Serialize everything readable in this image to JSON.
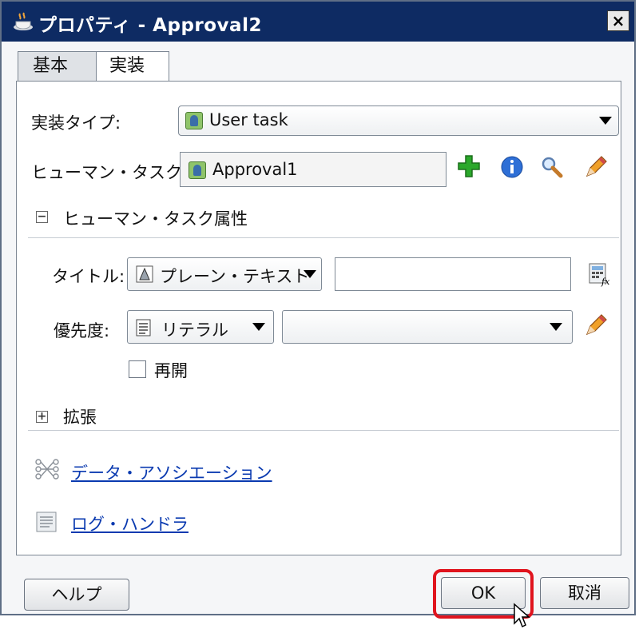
{
  "window": {
    "title": "プロパティ - Approval2",
    "close_label": "×"
  },
  "tabs": [
    {
      "label": "基本"
    },
    {
      "label": "実装"
    }
  ],
  "impl_type": {
    "label": "実装タイプ:",
    "value": "User task"
  },
  "human_task": {
    "label": "ヒューマン・タスク:",
    "value": "Approval1"
  },
  "attributes_section": {
    "label": "ヒューマン・タスク属性",
    "toggle": "−"
  },
  "title_field": {
    "label": "タイトル:",
    "mode": "プレーン・テキスト",
    "value": ""
  },
  "priority_field": {
    "label": "優先度:",
    "mode": "リテラル",
    "value": ""
  },
  "reopen": {
    "label": "再開",
    "checked": false
  },
  "extensions_section": {
    "label": "拡張",
    "toggle": "+"
  },
  "links": {
    "data_association": "データ・アソシエーション",
    "log_handler": "ログ・ハンドラ"
  },
  "buttons": {
    "help": "ヘルプ",
    "ok": "OK",
    "cancel": "取消"
  },
  "colors": {
    "titlebar": "#0e2b63",
    "link": "#0a3ab0",
    "highlight": "#e0141e",
    "accent_green": "#2aa82a"
  }
}
